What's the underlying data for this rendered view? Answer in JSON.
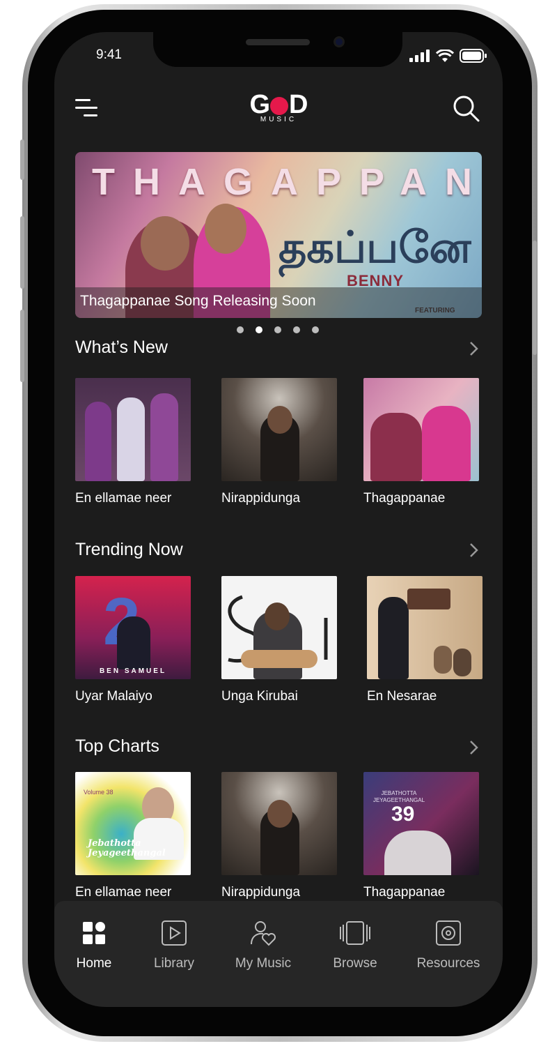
{
  "status": {
    "time": "9:41"
  },
  "header": {
    "logo_text_left": "G",
    "logo_text_right": "D",
    "logo_sub": "MUSIC"
  },
  "banner": {
    "headline": "THAGAPPANAE",
    "tamil_title": "தகப்பனே",
    "artist": "BENNY",
    "featuring": "FEATURING",
    "caption": "Thagappanae Song Releasing Soon",
    "active_slide": 2,
    "slide_count": 5
  },
  "sections": {
    "whats_new": {
      "title": "What’s New",
      "items": [
        {
          "title": "En ellamae neer"
        },
        {
          "title": "Nirappidunga"
        },
        {
          "title": "Thagappanae"
        }
      ]
    },
    "trending": {
      "title": "Trending Now",
      "items": [
        {
          "title": "Uyar Malaiyo",
          "cover_text": "BEN SAMUEL"
        },
        {
          "title": "Unga Kirubai"
        },
        {
          "title": "En Nesarae"
        }
      ]
    },
    "top_charts": {
      "title": "Top Charts",
      "items": [
        {
          "title": "En ellamae neer",
          "cover_text": "Jebathotta Jeyageethangal",
          "cover_volume": "Volume 38"
        },
        {
          "title": "Nirappidunga"
        },
        {
          "title": "Thagappanae",
          "cover_text": "JEBATHOTTA JEYAGEETHANGAL",
          "cover_volume": "39"
        }
      ]
    }
  },
  "tabbar": {
    "items": [
      {
        "label": "Home",
        "icon": "grid-icon",
        "active": true
      },
      {
        "label": "Library",
        "icon": "play-square-icon"
      },
      {
        "label": "My Music",
        "icon": "user-heart-icon"
      },
      {
        "label": "Browse",
        "icon": "carousel-icon"
      },
      {
        "label": "Resources",
        "icon": "disc-square-icon"
      }
    ]
  },
  "colors": {
    "background": "#1c1c1c",
    "tabbar": "#262626",
    "brand": "#e5194b"
  }
}
